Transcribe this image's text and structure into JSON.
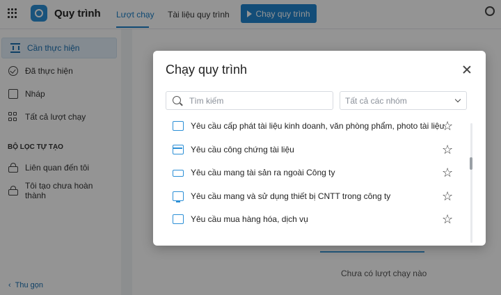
{
  "header": {
    "app_title": "Quy trình",
    "tabs": [
      {
        "label": "Lượt chạy",
        "active": true
      },
      {
        "label": "Tài liệu quy trình",
        "active": false
      }
    ],
    "run_button": "Chạy quy trình",
    "accent_color": "#1a7ec6"
  },
  "sidebar": {
    "items": [
      {
        "label": "Cần thực hiện",
        "icon": "hourglass-icon",
        "active": true
      },
      {
        "label": "Đã thực hiện",
        "icon": "check-circle-icon"
      },
      {
        "label": "Nháp",
        "icon": "edit-icon"
      },
      {
        "label": "Tất cả lượt chạy",
        "icon": "grid-icon"
      }
    ],
    "filter_section": "BỘ LỌC TỰ TẠO",
    "filters": [
      {
        "label": "Liên quan đến tôi",
        "icon": "lock-icon"
      },
      {
        "label": "Tôi tạo chưa hoàn thành",
        "icon": "lock-icon"
      }
    ],
    "collapse_label": "Thu gọn"
  },
  "main": {
    "empty_text": "Chưa có lượt chạy nào"
  },
  "modal": {
    "title": "Chạy quy trình",
    "search_placeholder": "Tìm kiếm",
    "group_select": "Tất cả các nhóm",
    "items": [
      {
        "label": "Yêu cầu cấp phát tài liệu kinh doanh, văn phòng phẩm, photo tài liệu",
        "icon": "box-icon"
      },
      {
        "label": "Yêu cầu công chứng tài liệu",
        "icon": "calendar-icon"
      },
      {
        "label": "Yêu cầu mang tài sản ra ngoài Công ty",
        "icon": "truck-icon"
      },
      {
        "label": "Yêu cầu mang và sử dụng thiết bị CNTT trong công ty",
        "icon": "monitor-icon"
      },
      {
        "label": "Yêu cầu mua hàng hóa, dịch vụ",
        "icon": "box-icon"
      }
    ]
  }
}
